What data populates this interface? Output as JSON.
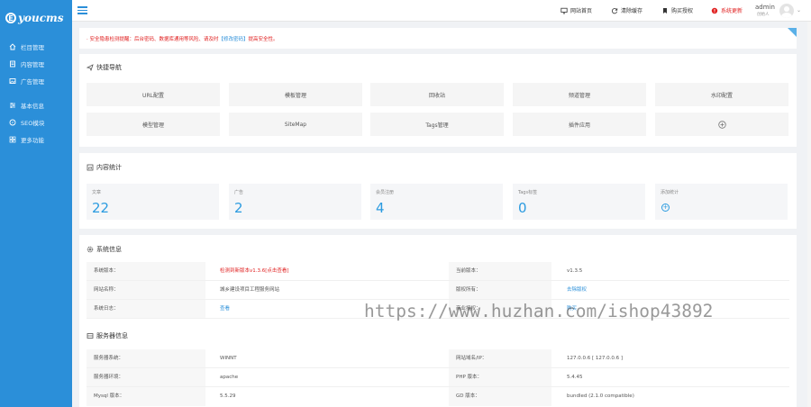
{
  "brand": {
    "logo_letter": "E",
    "logo_text": "youcms"
  },
  "sidebar": {
    "items": [
      {
        "label": "栏目管理",
        "icon": "home-icon"
      },
      {
        "label": "内容管理",
        "icon": "document-icon"
      },
      {
        "label": "广告管理",
        "icon": "image-icon"
      },
      {
        "label": "基本信息",
        "icon": "sliders-icon"
      },
      {
        "label": "SEO模块",
        "icon": "compass-icon"
      },
      {
        "label": "更多功能",
        "icon": "grid-icon"
      }
    ]
  },
  "topbar": {
    "site_home": "网站首页",
    "clear_cache": "清除缓存",
    "buy_license": "购买授权",
    "system_update": "系统更新",
    "user_name": "admin",
    "user_role": "创始人"
  },
  "notice": {
    "text_before": "· 安全隐患检测提醒：后台密码、数据库通用等风险、请及时",
    "link": "【修改密码】",
    "text_after": "提高安全性。"
  },
  "quicknav": {
    "title": "快捷导航",
    "buttons": [
      "URL配置",
      "模板管理",
      "回收站",
      "频道管理",
      "水印配置",
      "模型管理",
      "SiteMap",
      "Tags管理",
      "插件应用"
    ]
  },
  "stats": {
    "title": "内容统计",
    "items": [
      {
        "label": "文章",
        "value": "22"
      },
      {
        "label": "广告",
        "value": "2"
      },
      {
        "label": "会员注册",
        "value": "4"
      },
      {
        "label": "Tags标签",
        "value": "0"
      },
      {
        "label": "添加统计",
        "value": ""
      }
    ]
  },
  "system": {
    "title": "系统信息",
    "rows": [
      {
        "l1": "系统版本：",
        "v1": "检测到新版本v1.3.6[点击查看]",
        "l2": "当前版本：",
        "v2": "v1.3.5"
      },
      {
        "l1": "网站名称：",
        "v1": "城乡建设项目工程服务网站",
        "l2": "版权所有：",
        "v2": "去除版权"
      },
      {
        "l1": "系统日志：",
        "v1": "查看",
        "l2": "商业授权：",
        "v2": "购买"
      }
    ]
  },
  "server": {
    "title": "服务器信息",
    "rows": [
      {
        "l1": "服务器系统：",
        "v1": "WINNT",
        "l2": "网站域名/IP：",
        "v2": "127.0.0.6 [ 127.0.0.6 ]"
      },
      {
        "l1": "服务器环境：",
        "v1": "apache",
        "l2": "PHP 版本：",
        "v2": "5.4.45"
      },
      {
        "l1": "Mysql 版本：",
        "v1": "5.5.29",
        "l2": "GD 版本：",
        "v2": "bundled (2.1.0 compatible)"
      }
    ]
  },
  "watermark": "https://www.huzhan.com/ishop43892",
  "colors": {
    "sidebar": "#2b8fd9",
    "accent": "#2b9be0",
    "warning": "#e02020"
  }
}
